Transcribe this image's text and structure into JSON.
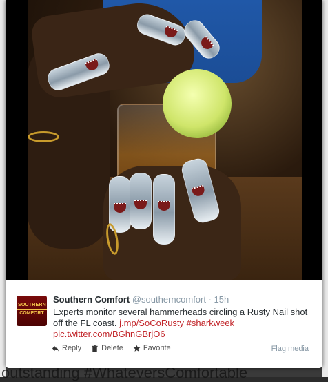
{
  "background": {
    "ghost_text": "outstanding #WhateversComfortable"
  },
  "tweet": {
    "avatar_brand_top": "SOUTHERN",
    "avatar_brand_bottom": "COMFORT",
    "name": "Southern Comfort",
    "handle": "@southerncomfort",
    "separator": " · ",
    "time": "15h",
    "text_main": "Experts monitor several hammerheads circling a Rusty Nail shot off the FL coast.",
    "link1": "j.mp/SoCoRusty",
    "hashtag": "#sharkweek",
    "link2": "pic.twitter.com/BGhnGBrjO6"
  },
  "actions": {
    "reply_label": "Reply",
    "delete_label": "Delete",
    "favorite_label": "Favorite",
    "flag_label": "Flag media"
  },
  "colors": {
    "link": "#c2252a",
    "avatar": "#7a0a0a"
  }
}
